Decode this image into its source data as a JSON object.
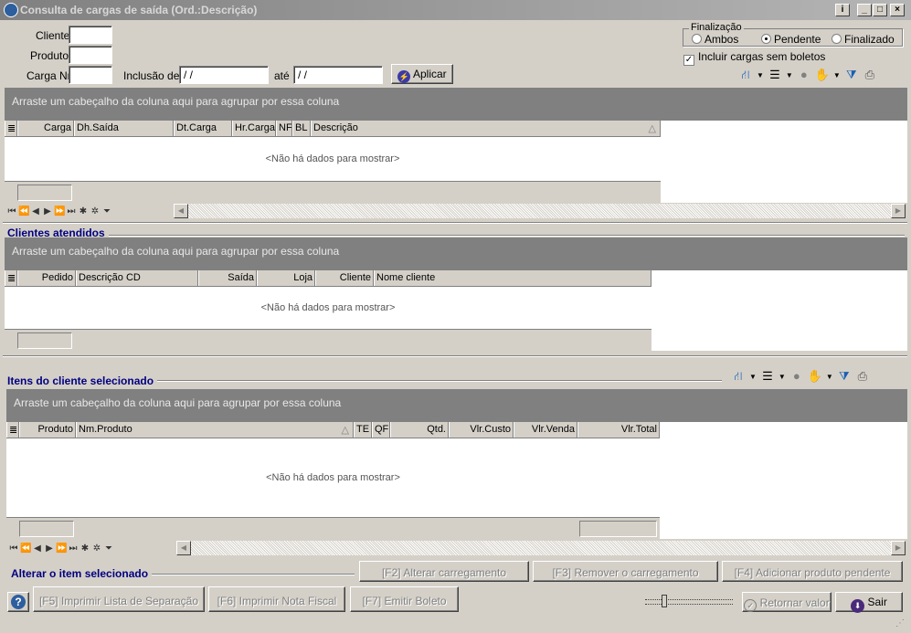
{
  "window": {
    "title": "Consulta de cargas de saída (Ord.:Descrição)"
  },
  "filters": {
    "cliente_label": "Cliente",
    "produto_label": "Produto",
    "carga_label": "Carga Nr",
    "inclusao_label": "Inclusão de",
    "ate_label": "até",
    "date_from": " / /",
    "date_to": " / /",
    "apply_label": "Aplicar"
  },
  "finalizacao": {
    "legend": "Finalização",
    "options": [
      "Ambos",
      "Pendente",
      "Finalizado"
    ],
    "selected": "Pendente",
    "include_label": "Incluir cargas sem boletos",
    "include_checked": true
  },
  "group_hint": "Arraste um cabeçalho da coluna aqui para agrupar por essa coluna",
  "empty_text": "<Não há dados para mostrar>",
  "grid1": {
    "columns": [
      "Carga",
      "Dh.Saída",
      "Dt.Carga",
      "Hr.Carga",
      "NF",
      "BL",
      "Descrição"
    ]
  },
  "clientes": {
    "title": "Clientes atendidos",
    "columns": [
      "Pedido",
      "Descrição CD",
      "Saída",
      "Loja",
      "Cliente",
      "Nome cliente"
    ]
  },
  "itens": {
    "title": "Itens do cliente selecionado",
    "columns": [
      "Produto",
      "Nm.Produto",
      "TE",
      "QF",
      "Qtd.",
      "Vlr.Custo",
      "Vlr.Venda",
      "Vlr.Total"
    ]
  },
  "alterar": {
    "title": "Alterar o item selecionado"
  },
  "buttons": {
    "f2": "[F2] Alterar carregamento",
    "f3": "[F3] Remover o carregamento",
    "f4": "[F4] Adicionar produto pendente",
    "f5": "[F5] Imprimir Lista de Separação",
    "f6": "[F6] Imprimir Nota Fiscal",
    "f7": "[F7] Emitir Boleto",
    "retornar": "Retornar valor",
    "sair": "Sair"
  },
  "icons": [
    "hierarchy-icon",
    "list-tree-icon",
    "circle-icon",
    "hand-icon",
    "filter-icon",
    "printer-icon"
  ]
}
